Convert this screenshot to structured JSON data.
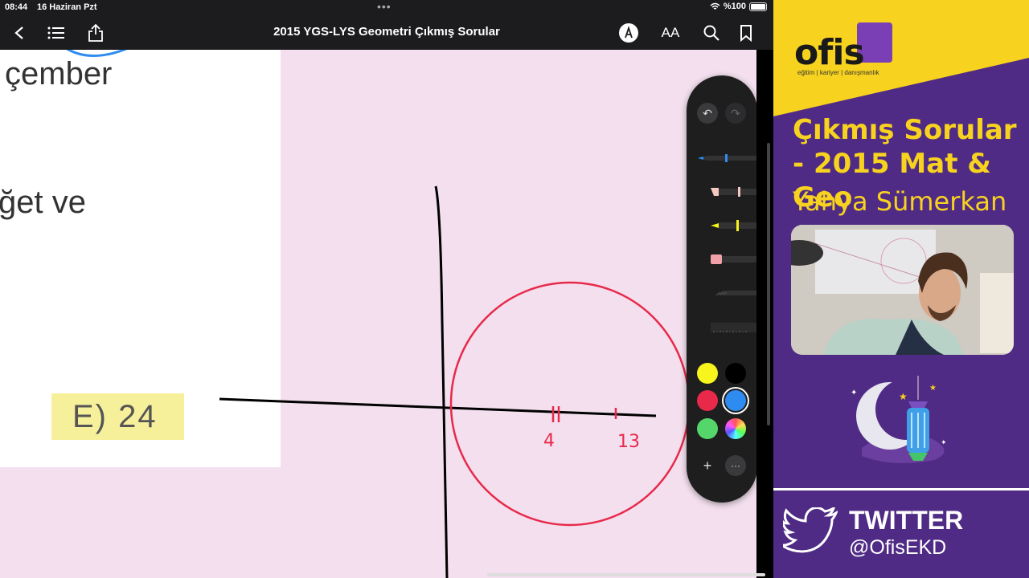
{
  "status_bar": {
    "time": "08:44",
    "date": "16 Haziran Pzt",
    "battery": "%100"
  },
  "toolbar": {
    "title": "2015 YGS-LYS Geometri Çıkmış Sorular",
    "text_size_label": "AA",
    "icons": [
      "back-chevron-icon",
      "list-icon",
      "share-icon",
      "markup-pen-icon",
      "search-icon",
      "bookmark-icon"
    ]
  },
  "document": {
    "line1": "çember",
    "line2": "ğet ve",
    "answer_option": "E) 24"
  },
  "drawing": {
    "label_left": "4",
    "label_right": "13",
    "ink_colors": {
      "axes": "#000000",
      "circle": "#e8294a"
    }
  },
  "palette": {
    "tools": [
      "pen",
      "marker",
      "highlighter",
      "eraser",
      "lasso",
      "ruler"
    ],
    "colors": [
      "#f7f51b",
      "#000000",
      "#e8294a",
      "#2e8cf0",
      "#55d66a",
      "multicolor"
    ],
    "selected_color": "#2e8cf0",
    "add_label": "+",
    "more_label": "···"
  },
  "side_panel": {
    "brand": "ofis",
    "brand_tagline": "eğitim | kariyer | danışmanlık",
    "series_title": "Çıkmış Sorular - 2015 Mat & Geo",
    "host": "Yahya Sümerkan",
    "social_label": "TWITTER",
    "social_handle": "@OfisEKD",
    "accent_yellow": "#f7d21e",
    "accent_purple": "#4f2b85"
  }
}
